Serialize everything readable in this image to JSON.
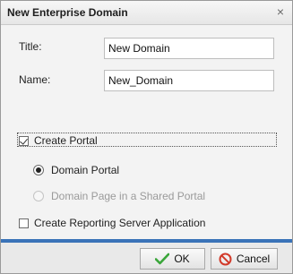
{
  "dialog": {
    "title": "New Enterprise Domain",
    "close_glyph": "×"
  },
  "form": {
    "title_label": "Title:",
    "title_value": "New Domain",
    "name_label": "Name:",
    "name_value": "New_Domain",
    "create_portal_label": "Create Portal",
    "create_portal_checked": true,
    "radio_domain_portal_label": "Domain Portal",
    "radio_domain_portal_selected": true,
    "radio_shared_portal_label": "Domain Page in a Shared Portal",
    "radio_shared_portal_enabled": false,
    "create_reporting_label": "Create Reporting Server Application",
    "create_reporting_checked": false
  },
  "buttons": {
    "ok_label": "OK",
    "ok_icon": "checkmark-icon",
    "cancel_label": "Cancel",
    "cancel_icon": "no-entry-icon"
  },
  "colors": {
    "accent_bar": "#3a73b8",
    "ok_icon": "#3aa63a",
    "cancel_icon": "#d23a2a"
  }
}
